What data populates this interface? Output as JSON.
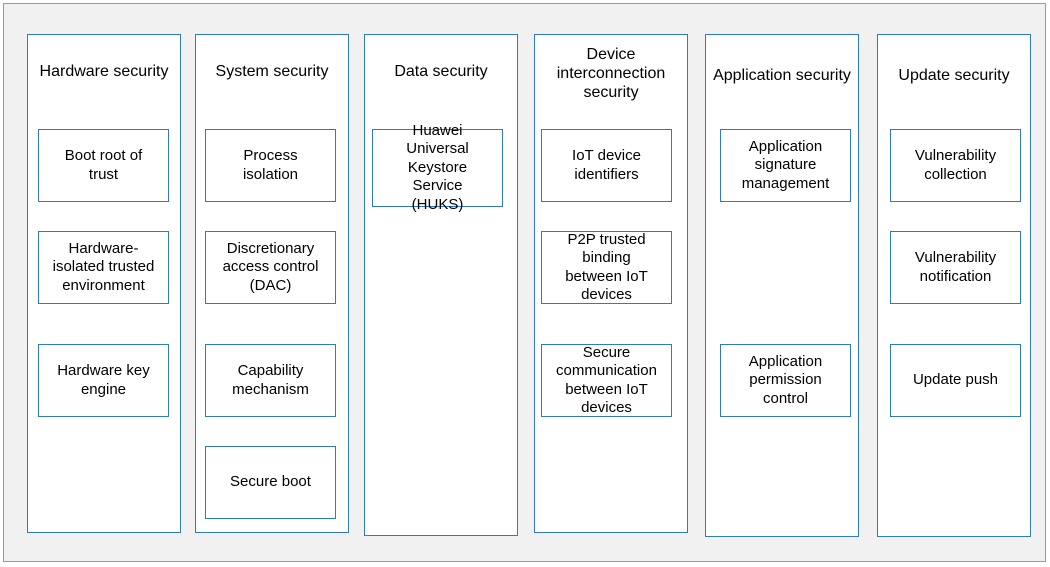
{
  "columns": [
    {
      "title": "Hardware security",
      "items": [
        "Boot root of trust",
        "Hardware-isolated trusted environment",
        "Hardware key engine"
      ]
    },
    {
      "title": "System security",
      "items": [
        "Process isolation",
        "Discretionary access control (DAC)",
        "Capability mechanism",
        "Secure boot"
      ]
    },
    {
      "title": "Data security",
      "items": [
        "Huawei Universal Keystore Service (HUKS)"
      ]
    },
    {
      "title": "Device interconnection security",
      "items": [
        "IoT device identifiers",
        "P2P trusted binding between IoT devices",
        "Secure communication between IoT devices"
      ]
    },
    {
      "title": "Application security",
      "items": [
        "Application signature management",
        "Application permission control"
      ]
    },
    {
      "title": "Update security",
      "items": [
        "Vulnerability collection",
        "Vulnerability notification",
        "Update push"
      ]
    }
  ]
}
